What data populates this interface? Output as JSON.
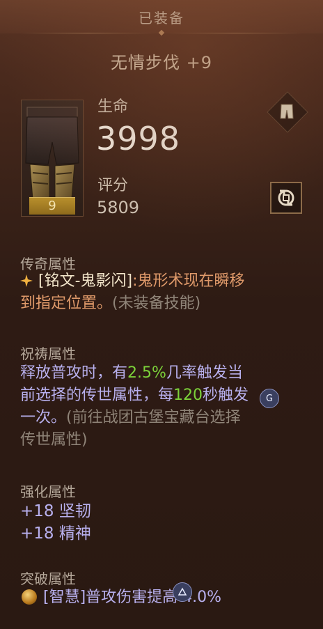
{
  "header": {
    "title": "已装备"
  },
  "item": {
    "name": "无情步伐 +9",
    "level": "9",
    "slot_icon": "pants-icon",
    "swap_icon": "compare-swap-icon"
  },
  "stats": {
    "life_label": "生命",
    "life_value": "3998",
    "score_label": "评分",
    "score_value": "5809"
  },
  "legendary": {
    "title": "传奇属性",
    "name": "[铭文-鬼影闪]",
    "desc_line1": ":鬼形术现在瞬移",
    "desc_line2": "到指定位置。",
    "hint": "(未装备技能)"
  },
  "blessing": {
    "title": "祝祷属性",
    "line1_a": "释放普攻时，有",
    "line1_pct": "2.5%",
    "line1_b": "几率触发当",
    "line2_a": "前选择的传世属性，每",
    "line2_sec": "120",
    "line2_b": "秒触发",
    "line3_a": "一次。",
    "line3_hint": "(前往战团古堡宝藏台选择",
    "line4_hint": "传世属性)"
  },
  "enhance": {
    "title": "强化属性",
    "line1": "+18 坚韧",
    "line2": "+18 精神"
  },
  "breakthrough": {
    "title": "突破属性",
    "text": "[智慧]普攻伤害提高 4.0%"
  },
  "overlay": {
    "g_label": "G"
  },
  "colors": {
    "legendary": "#e09a6a",
    "blessing": "#b8b0ee",
    "highlight": "#7cd23a",
    "hint": "#8f8478",
    "level_badge": "#b88f2c"
  }
}
